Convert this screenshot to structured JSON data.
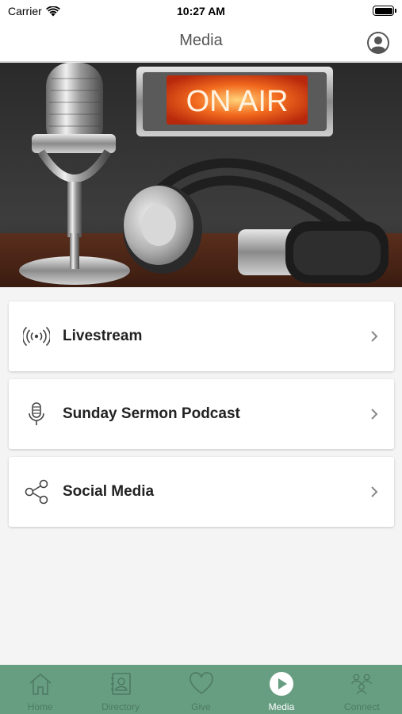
{
  "status_bar": {
    "carrier": "Carrier",
    "time": "10:27 AM"
  },
  "nav": {
    "title": "Media",
    "profile_icon": "person-circle-icon"
  },
  "hero": {
    "sign_text": "ON AIR"
  },
  "menu": [
    {
      "label": "Livestream",
      "icon": "broadcast-icon"
    },
    {
      "label": "Sunday Sermon Podcast",
      "icon": "microphone-icon"
    },
    {
      "label": "Social Media",
      "icon": "share-icon"
    }
  ],
  "tabs": [
    {
      "label": "Home",
      "icon": "home-icon",
      "active": false
    },
    {
      "label": "Directory",
      "icon": "address-book-icon",
      "active": false
    },
    {
      "label": "Give",
      "icon": "heart-icon",
      "active": false
    },
    {
      "label": "Media",
      "icon": "play-circle-icon",
      "active": true
    },
    {
      "label": "Connect",
      "icon": "people-icon",
      "active": false
    }
  ],
  "colors": {
    "tab_bar": "#679e81",
    "tab_inactive": "#4d7a62",
    "tab_active": "#ffffff",
    "on_air": "#f05a1a"
  }
}
